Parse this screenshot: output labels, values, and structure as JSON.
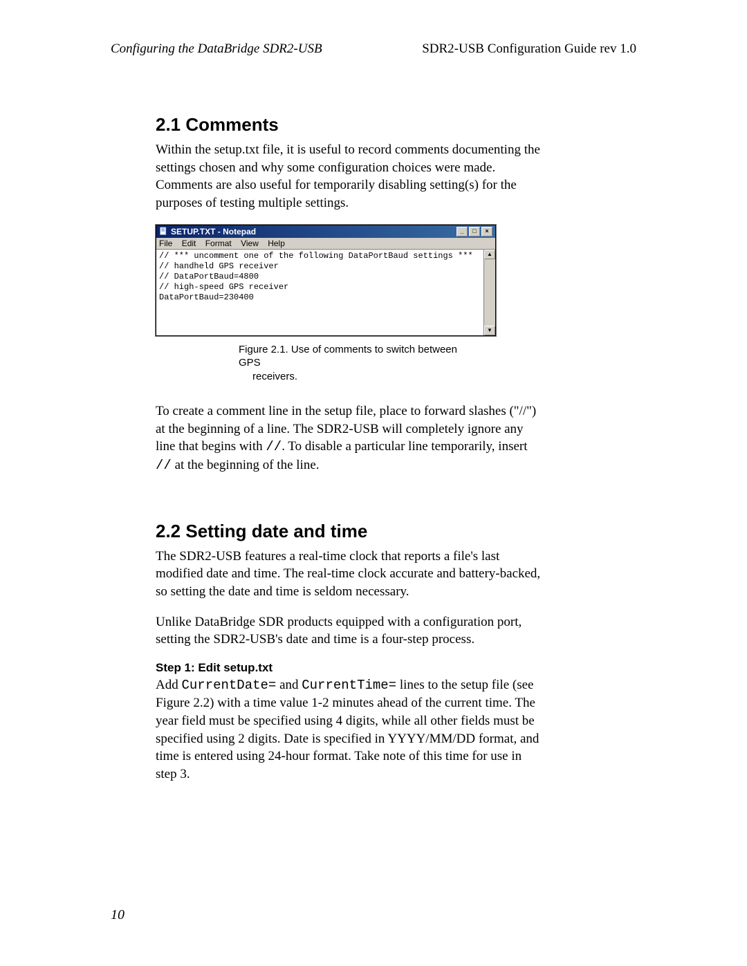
{
  "header": {
    "left": "Configuring the DataBridge SDR2-USB",
    "right": "SDR2-USB Configuration Guide rev 1.0"
  },
  "sections": {
    "s21_title": "2.1  Comments",
    "s21_p1": "Within the setup.txt file, it is useful to record comments documenting the settings chosen and why some configuration choices were made.  Comments are also useful for temporarily disabling setting(s) for the purposes of testing multiple settings.",
    "s21_p2a": "To create a comment line in the setup file, place to forward slashes (\"//\") at the beginning of a line.  The SDR2-USB will completely ignore any line that begins with  ",
    "s21_p2_code1": "//",
    "s21_p2b": ".  To disable a particular line temporarily, insert  ",
    "s21_p2_code2": "//",
    "s21_p2c": "  at the beginning of the line.",
    "s22_title": "2.2  Setting date and time",
    "s22_p1": "The SDR2-USB features a real-time clock that reports a file's last modified date and time. The real-time clock accurate and battery-backed, so setting the date and time is seldom necessary.",
    "s22_p2": "Unlike DataBridge SDR products equipped with a configuration port, setting the SDR2-USB's date and time is a four-step process.",
    "step1_title": "Step 1: Edit setup.txt",
    "step1_a": "Add ",
    "step1_code1": "CurrentDate=",
    "step1_b": " and ",
    "step1_code2": "CurrentTime=",
    "step1_c": " lines to the setup file (see Figure 2.2) with a time value 1-2 minutes ahead of the current time.  The year field must be specified using 4 digits, while all other fields must be specified using 2 digits.  Date is specified in YYYY/MM/DD format, and time is entered using 24-hour format.  Take note of this time for use in step 3."
  },
  "notepad": {
    "title": "SETUP.TXT - Notepad",
    "menu": {
      "file": "File",
      "edit": "Edit",
      "format": "Format",
      "view": "View",
      "help": "Help"
    },
    "controls": {
      "min": "_",
      "max": "□",
      "close": "×"
    },
    "scroll": {
      "up": "▲",
      "down": "▼"
    },
    "body": "// *** uncomment one of the following DataPortBaud settings ***\n// handheld GPS receiver\n// DataPortBaud=4800\n// high-speed GPS receiver\nDataPortBaud=230400"
  },
  "figure_caption": {
    "line1": "Figure 2.1. Use of comments to switch between GPS",
    "line2": "receivers."
  },
  "page_number": "10"
}
